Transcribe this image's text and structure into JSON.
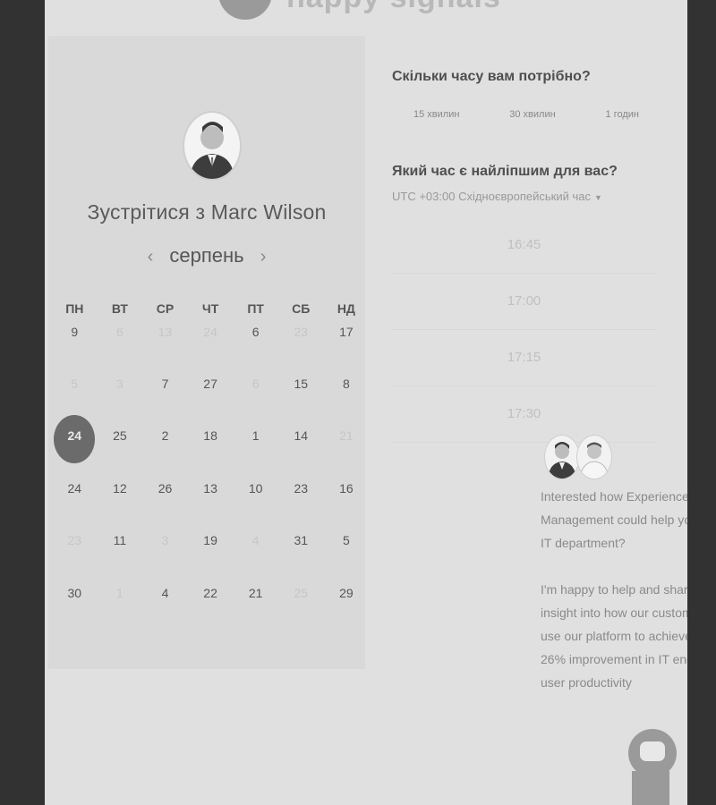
{
  "header": {
    "logo_text": "happy signals"
  },
  "host": {
    "title": "Зустрітися з Marc Wilson"
  },
  "calendar": {
    "month": "серпень",
    "prev_arrow": "‹",
    "next_arrow": "›",
    "weekdays": [
      "ПН",
      "ВТ",
      "СР",
      "ЧТ",
      "ПТ",
      "СБ",
      "НД"
    ],
    "weeks": [
      [
        "9",
        "6",
        "13",
        "24",
        "6",
        "23",
        "17"
      ],
      [
        "5",
        "3",
        "7",
        "27",
        "6",
        "15",
        "8"
      ],
      [
        "24",
        "25",
        "2",
        "18",
        "1",
        "14",
        "21"
      ],
      [
        "24",
        "12",
        "26",
        "13",
        "10",
        "23",
        "16"
      ],
      [
        "23",
        "11",
        "3",
        "19",
        "4",
        "31",
        "5"
      ],
      [
        "30",
        "1",
        "4",
        "22",
        "21",
        "25",
        "29"
      ]
    ],
    "selected": "24"
  },
  "duration": {
    "question": "Скільки часу вам потрібно?",
    "options": [
      "15 хвилин",
      "30 хвилин",
      "1 годин"
    ]
  },
  "time": {
    "question": "Який час є найліпшим для вас?",
    "timezone": "UTC +03:00 Східноєвропейський час",
    "slots": [
      "16:45",
      "17:00",
      "17:15",
      "17:30"
    ]
  },
  "chat": {
    "close_symbol": "×",
    "message_p1": "Interested how Experience Management could help your IT department?",
    "message_p2": "I'm happy to help and share insight into how our customers use our platform to achieve 26% improvement in IT end-user productivity"
  },
  "colors": {
    "background": "#323232",
    "page": "#e0e0e0",
    "selected_day": "#6b6b6b"
  }
}
